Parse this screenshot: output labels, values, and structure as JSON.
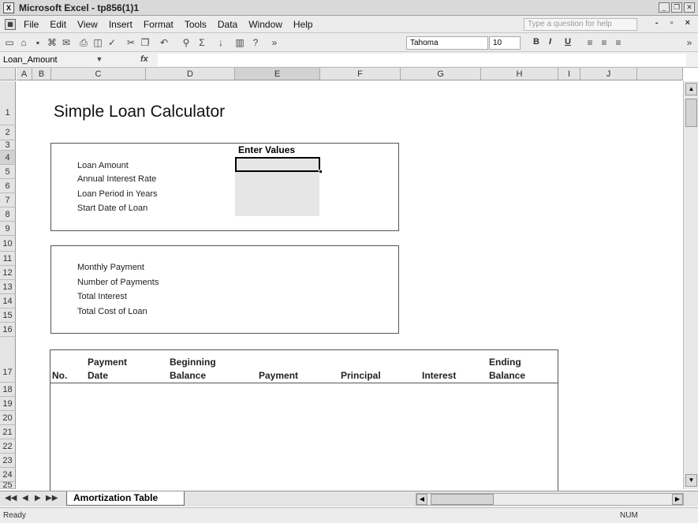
{
  "window": {
    "title": "Microsoft Excel - tp856(1)1",
    "app_icon": "excel-icon",
    "buttons": [
      "minimize",
      "restore",
      "close"
    ]
  },
  "menu": {
    "items": [
      "File",
      "Edit",
      "View",
      "Insert",
      "Format",
      "Tools",
      "Data",
      "Window",
      "Help"
    ],
    "help_placeholder": "Type a question for help"
  },
  "toolbar": {
    "font": "Tahoma",
    "size": "10",
    "bold": "B",
    "italic": "I",
    "underline": "U"
  },
  "formula_bar": {
    "name_box": "Loan_Amount",
    "fx": "fx",
    "formula": ""
  },
  "grid": {
    "columns": [
      "A",
      "B",
      "C",
      "D",
      "E",
      "F",
      "G",
      "H",
      "I",
      "J"
    ],
    "selected_column": "E",
    "rows": [
      "1",
      "2",
      "3",
      "4",
      "5",
      "6",
      "7",
      "8",
      "9",
      "10",
      "11",
      "12",
      "13",
      "14",
      "15",
      "16",
      "17",
      "18",
      "19",
      "20",
      "21",
      "22",
      "23",
      "24",
      "25"
    ]
  },
  "sheet": {
    "title": "Simple Loan Calculator",
    "enter_values_header": "Enter Values",
    "input_labels": [
      "Loan Amount",
      "Annual Interest Rate",
      "Loan Period in Years",
      "Start Date of Loan"
    ],
    "output_labels": [
      "Monthly Payment",
      "Number of Payments",
      "Total Interest",
      "Total Cost of Loan"
    ],
    "table_headers": {
      "no": "No.",
      "payment_date_1": "Payment",
      "payment_date_2": "Date",
      "beginning_balance_1": "Beginning",
      "beginning_balance_2": "Balance",
      "payment": "Payment",
      "principal": "Principal",
      "interest": "Interest",
      "ending_balance_1": "Ending",
      "ending_balance_2": "Balance"
    }
  },
  "tabs": {
    "active": "Amortization Table"
  },
  "status": {
    "text": "Ready",
    "num": "NUM"
  }
}
